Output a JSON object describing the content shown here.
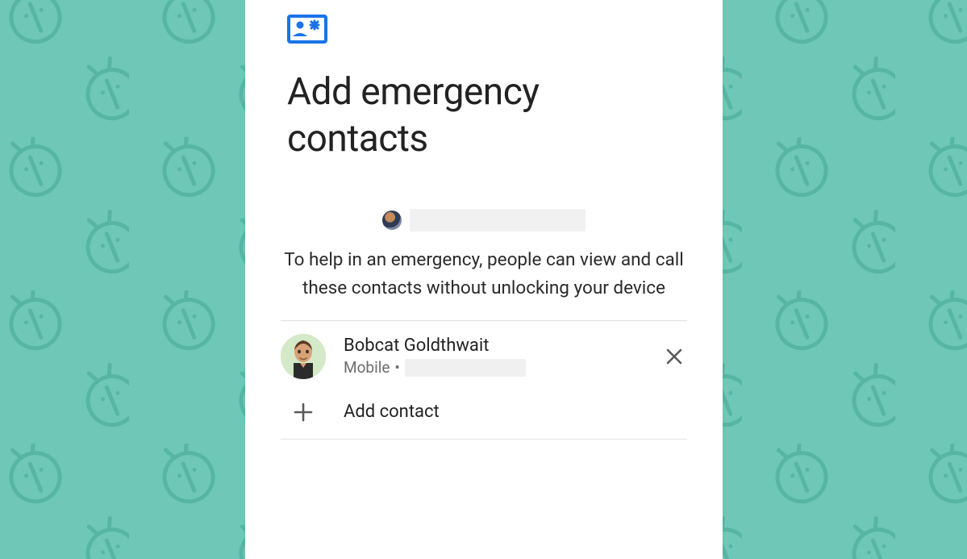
{
  "title": "Add emergency contacts",
  "description": "To help in an emergency, people can view and call these contacts without unlocking your device",
  "owner": {
    "name_redacted": true
  },
  "contacts": [
    {
      "name": "Bobcat Goldthwait",
      "phone_type": "Mobile",
      "phone_separator": "•",
      "phone_redacted": true
    }
  ],
  "add_contact_label": "Add contact",
  "icons": {
    "header": "emergency-card-icon",
    "remove": "close-icon",
    "add": "plus-icon"
  },
  "colors": {
    "accent": "#1a73e8",
    "bg": "#6fc7b7"
  }
}
